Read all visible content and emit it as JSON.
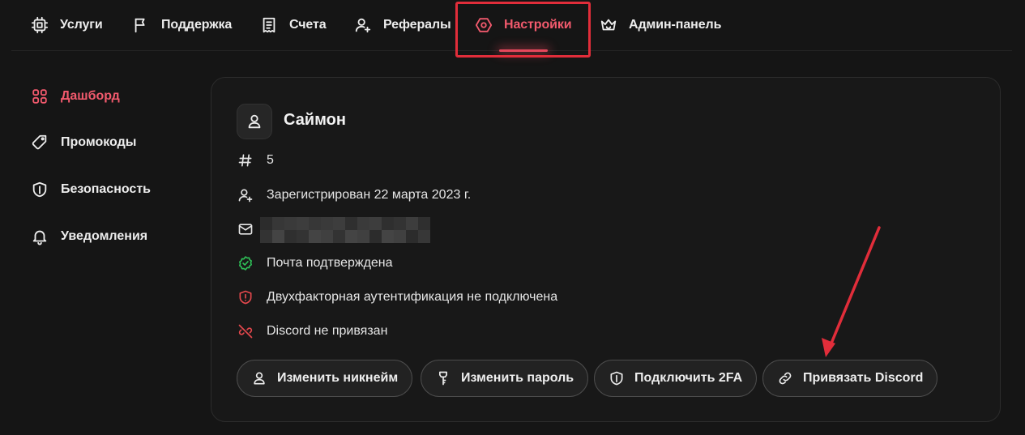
{
  "colors": {
    "background": "#151515",
    "card": "#181818",
    "accent": "#f25a6d",
    "success": "#2fbf57",
    "danger": "#e5484d",
    "annotation": "#e12d3a"
  },
  "topnav": {
    "items": [
      {
        "label": "Услуги",
        "icon": "cpu-icon"
      },
      {
        "label": "Поддержка",
        "icon": "flag-icon"
      },
      {
        "label": "Счета",
        "icon": "receipt-icon"
      },
      {
        "label": "Рефералы",
        "icon": "user-plus-icon"
      },
      {
        "label": "Настройки",
        "icon": "settings-icon",
        "active": true
      },
      {
        "label": "Админ-панель",
        "icon": "crown-icon"
      }
    ]
  },
  "sidebar": {
    "items": [
      {
        "label": "Дашборд",
        "icon": "grid-icon",
        "active": true
      },
      {
        "label": "Промокоды",
        "icon": "tag-icon"
      },
      {
        "label": "Безопасность",
        "icon": "shield-icon"
      },
      {
        "label": "Уведомления",
        "icon": "bell-icon"
      }
    ]
  },
  "profile": {
    "username": "Саймон",
    "id": "5",
    "registered": "Зарегистрирован 22 марта 2023 г.",
    "email_status": "Почта подтверждена",
    "twofa_status": "Двухфакторная аутентификация не подключена",
    "discord_status": "Discord не привязан"
  },
  "actions": {
    "change_nickname": "Изменить никнейм",
    "change_password": "Изменить пароль",
    "enable_2fa": "Подключить 2FA",
    "link_discord": "Привязать Discord"
  }
}
